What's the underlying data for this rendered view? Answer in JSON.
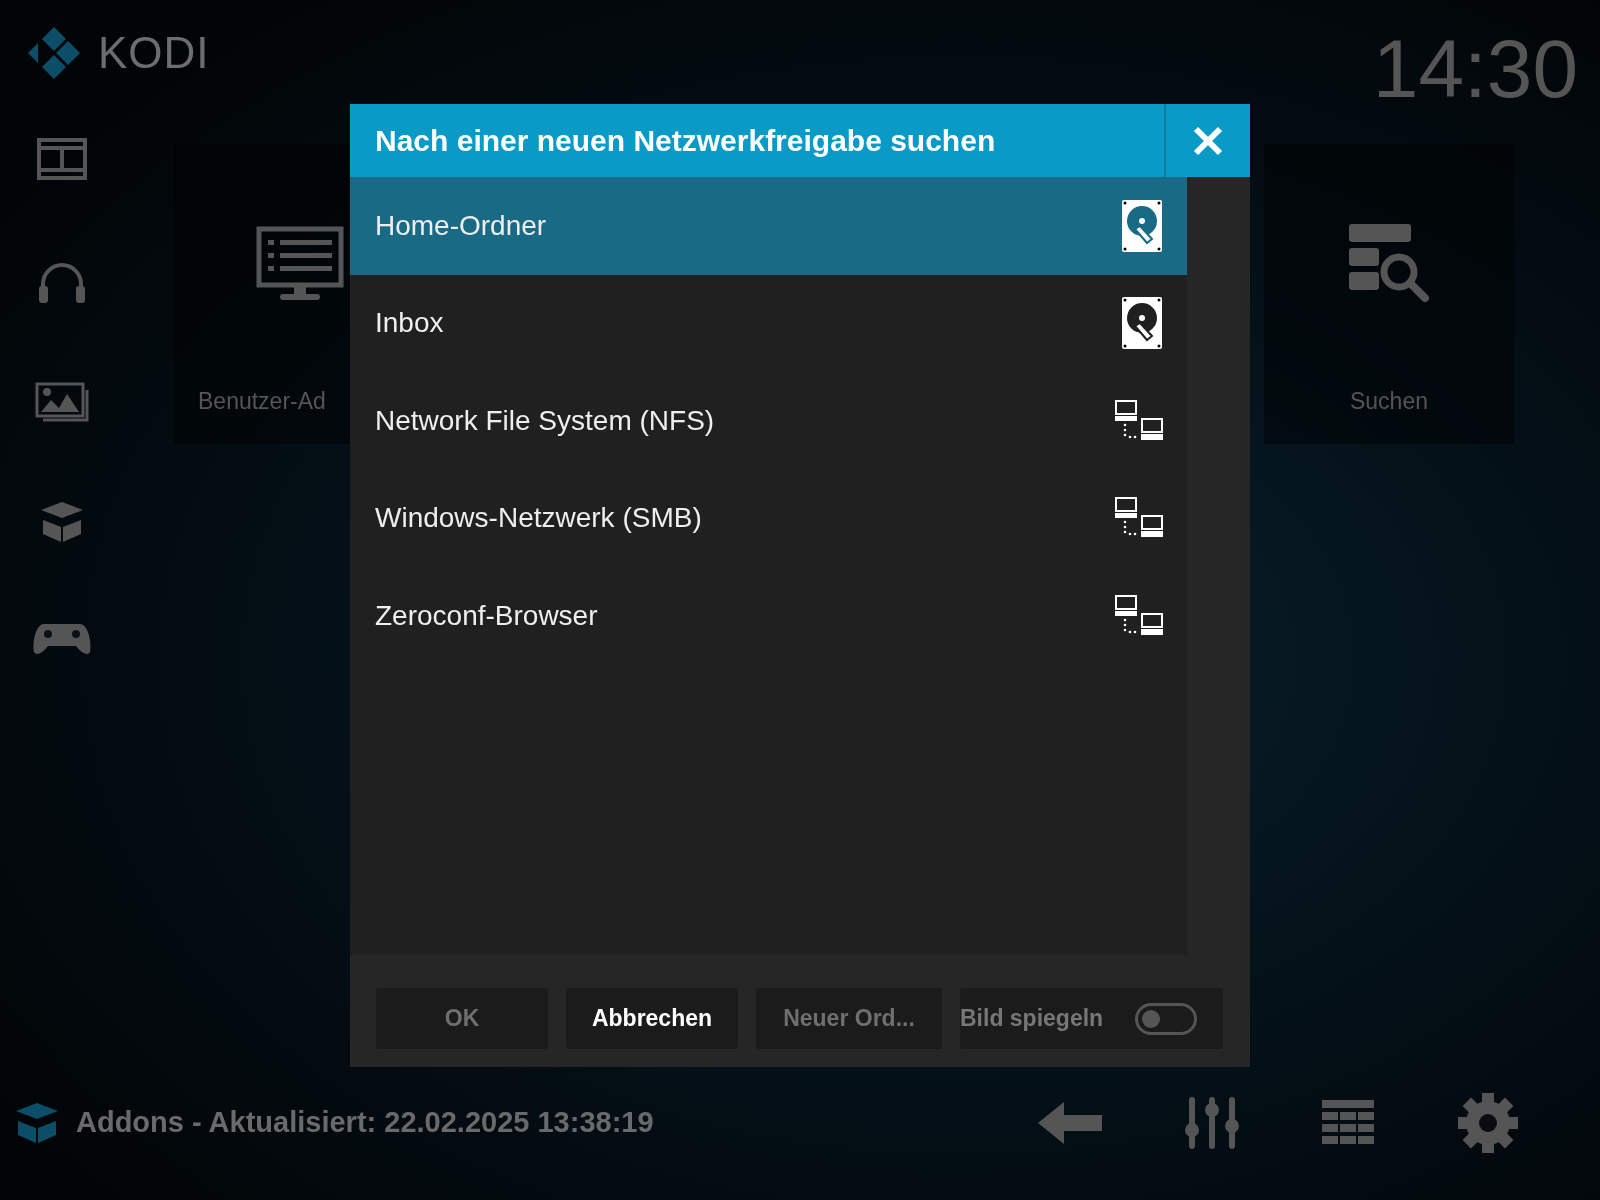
{
  "header": {
    "logo": "KODI",
    "clock": "14:30"
  },
  "tiles": [
    {
      "label": "Benutzer-Ad",
      "kind": "monitor"
    },
    {
      "label": "Suchen",
      "kind": "search"
    }
  ],
  "dialog": {
    "title": "Nach einer neuen Netzwerkfreigabe suchen",
    "items": [
      {
        "label": "Home-Ordner",
        "kind": "drive",
        "selected": true
      },
      {
        "label": "Inbox",
        "kind": "drive",
        "selected": false
      },
      {
        "label": "Network File System (NFS)",
        "kind": "network",
        "selected": false
      },
      {
        "label": "Windows-Netzwerk (SMB)",
        "kind": "network",
        "selected": false
      },
      {
        "label": "Zeroconf-Browser",
        "kind": "network",
        "selected": false
      }
    ],
    "buttons": [
      {
        "label": "OK",
        "kind": "button",
        "disabled": true
      },
      {
        "label": "Abbrechen",
        "kind": "button",
        "disabled": false
      },
      {
        "label": "Neuer Ord...",
        "kind": "button",
        "disabled": true
      },
      {
        "label": "Bild spiegeln",
        "kind": "toggle",
        "on": false
      }
    ]
  },
  "status_bar": {
    "text": "Addons - Aktualisiert: 22.02.2025 13:38:19"
  }
}
